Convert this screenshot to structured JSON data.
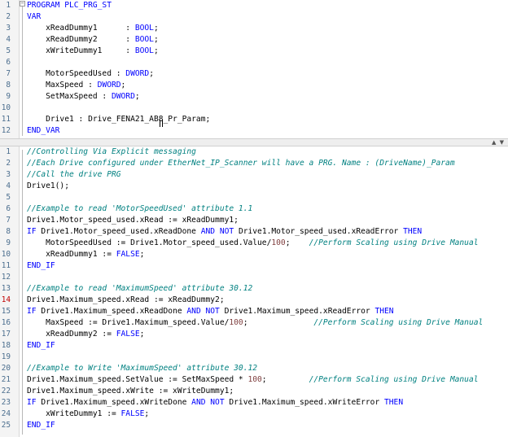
{
  "declaration": {
    "lines": [
      [
        {
          "t": "PROGRAM PLC_PRG_ST",
          "c": "kw"
        }
      ],
      [
        {
          "t": "VAR",
          "c": "kw"
        }
      ],
      [
        {
          "t": "    xReadDummy1      : "
        },
        {
          "t": "BOOL",
          "c": "kw"
        },
        {
          "t": ";"
        }
      ],
      [
        {
          "t": "    xReadDummy2      : "
        },
        {
          "t": "BOOL",
          "c": "kw"
        },
        {
          "t": ";"
        }
      ],
      [
        {
          "t": "    xWriteDummy1     : "
        },
        {
          "t": "BOOL",
          "c": "kw"
        },
        {
          "t": ";"
        }
      ],
      [],
      [
        {
          "t": "    MotorSpeedUsed : "
        },
        {
          "t": "DWORD",
          "c": "kw"
        },
        {
          "t": ";"
        }
      ],
      [
        {
          "t": "    MaxSpeed : "
        },
        {
          "t": "DWORD",
          "c": "kw"
        },
        {
          "t": ";"
        }
      ],
      [
        {
          "t": "    SetMaxSpeed : "
        },
        {
          "t": "DWORD",
          "c": "kw"
        },
        {
          "t": ";"
        }
      ],
      [],
      [
        {
          "t": "    Drive1 : Drive_FENA21_AB8_Pr_Param;"
        }
      ],
      [
        {
          "t": "END_VAR",
          "c": "kw"
        }
      ]
    ]
  },
  "implementation": {
    "marked_line": 14,
    "lines": [
      [
        {
          "t": "//Controlling Via Explicit messaging",
          "c": "cm"
        }
      ],
      [
        {
          "t": "//Each Drive configured under EtherNet_IP_Scanner will have a PRG. Name : (DriveName)_Param",
          "c": "cm"
        }
      ],
      [
        {
          "t": "//Call the drive PRG",
          "c": "cm"
        }
      ],
      [
        {
          "t": "Drive1();"
        }
      ],
      [],
      [
        {
          "t": "//Example to read 'MotorSpeedUsed' attribute 1.1",
          "c": "cm"
        }
      ],
      [
        {
          "t": "Drive1.Motor_speed_used.xRead := xReadDummy1;"
        }
      ],
      [
        {
          "t": "IF",
          "c": "kw"
        },
        {
          "t": " Drive1.Motor_speed_used.xReadDone "
        },
        {
          "t": "AND NOT",
          "c": "kw"
        },
        {
          "t": " Drive1.Motor_speed_used.xReadError "
        },
        {
          "t": "THEN",
          "c": "kw"
        }
      ],
      [
        {
          "t": "    MotorSpeedUsed := Drive1.Motor_speed_used.Value/"
        },
        {
          "t": "100",
          "c": "nm"
        },
        {
          "t": ";    "
        },
        {
          "t": "//Perform Scaling using Drive Manual",
          "c": "cm"
        }
      ],
      [
        {
          "t": "    xReadDummy1 := "
        },
        {
          "t": "FALSE",
          "c": "kw"
        },
        {
          "t": ";"
        }
      ],
      [
        {
          "t": "END_IF",
          "c": "kw"
        }
      ],
      [],
      [
        {
          "t": "//Example to read 'MaximumSpeed' attribute 30.12",
          "c": "cm"
        }
      ],
      [
        {
          "t": "Drive1.Maximum_speed.xRead := xReadDummy2;"
        }
      ],
      [
        {
          "t": "IF",
          "c": "kw"
        },
        {
          "t": " Drive1.Maximum_speed.xReadDone "
        },
        {
          "t": "AND NOT",
          "c": "kw"
        },
        {
          "t": " Drive1.Maximum_speed.xReadError "
        },
        {
          "t": "THEN",
          "c": "kw"
        }
      ],
      [
        {
          "t": "    MaxSpeed := Drive1.Maximum_speed.Value/"
        },
        {
          "t": "100",
          "c": "nm"
        },
        {
          "t": ";              "
        },
        {
          "t": "//Perform Scaling using Drive Manual",
          "c": "cm"
        }
      ],
      [
        {
          "t": "    xReadDummy2 := "
        },
        {
          "t": "FALSE",
          "c": "kw"
        },
        {
          "t": ";"
        }
      ],
      [
        {
          "t": "END_IF",
          "c": "kw"
        }
      ],
      [],
      [
        {
          "t": "//Example to Write 'MaximumSpeed' attribute 30.12",
          "c": "cm"
        }
      ],
      [
        {
          "t": "Drive1.Maximum_speed.SetValue := SetMaxSpeed * "
        },
        {
          "t": "100",
          "c": "nm"
        },
        {
          "t": ";         "
        },
        {
          "t": "//Perform Scaling using Drive Manual",
          "c": "cm"
        }
      ],
      [
        {
          "t": "Drive1.Maximum_speed.xWrite := xWriteDummy1;"
        }
      ],
      [
        {
          "t": "IF",
          "c": "kw"
        },
        {
          "t": " Drive1.Maximum_speed.xWriteDone "
        },
        {
          "t": "AND NOT",
          "c": "kw"
        },
        {
          "t": " Drive1.Maximum_speed.xWriteError "
        },
        {
          "t": "THEN",
          "c": "kw"
        }
      ],
      [
        {
          "t": "    xWriteDummy1 := "
        },
        {
          "t": "FALSE",
          "c": "kw"
        },
        {
          "t": ";"
        }
      ],
      [
        {
          "t": "END_IF",
          "c": "kw"
        }
      ]
    ]
  },
  "splitter": {
    "up_icon": "triangle-up-icon",
    "down_icon": "triangle-down-icon"
  },
  "colors": {
    "keyword": "#0000ff",
    "comment": "#008080",
    "number": "#804040",
    "line_number": "#4d6f8f",
    "marked_line_number": "#c00000"
  }
}
